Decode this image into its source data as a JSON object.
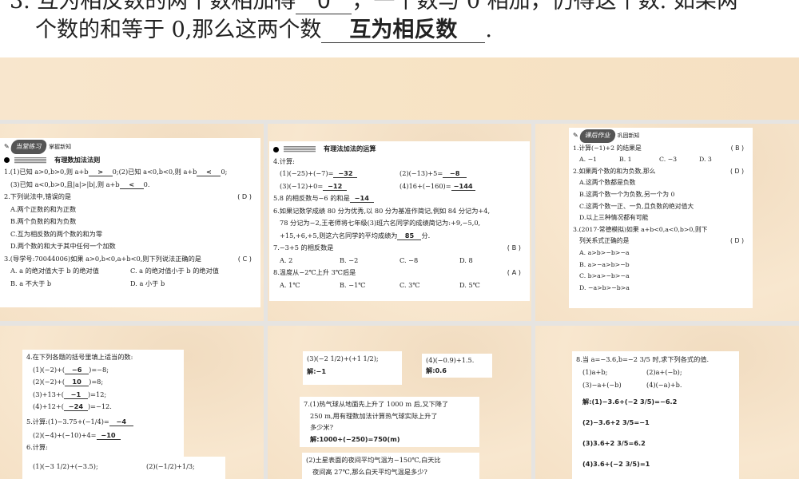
{
  "top": {
    "line1_pre": "3. 互为相反数的两个数相加得",
    "line1_ans": "0",
    "line1_post": "，一个数与 0 相加，仍得这个数. 如果两",
    "line2_pre": "个数的和等于 0,那么这两个数",
    "line2_ans": "互为相反数",
    "line2_post": "."
  },
  "s1": {
    "badge": "当堂练习",
    "badge2": "掌握新知",
    "section": "有理数加法法则",
    "q1a": "1.(1)已知 a>0,b>0,则 a+b",
    "a1": ">",
    "q1b": "0;(2)已知 a<0,b<0,则 a+b",
    "a2": "<",
    "q1c": "0;",
    "q1d": "(3)已知 a<0,b>0,且|a|>|b|,则 a+b",
    "a3": "<",
    "q1e": "0.",
    "q2": "2.下列说法中,错误的是",
    "q2ans": "( D )",
    "q2opts": [
      "A.两个正数的和为正数",
      "B.两个负数的和为负数",
      "C.互为相反数的两个数的和为零",
      "D.两个数的和大于其中任何一个加数"
    ],
    "q3": "3.(导学号:70044006)如果 a>0,b<0,a+b<0,则下列说法正确的是",
    "q3ans": "( C )",
    "q3opts": [
      "A. a 的绝对值大于 b 的绝对值",
      "C. a 的绝对值小于 b 的绝对值",
      "B. a 不大于 b",
      "D. a 小于 b"
    ]
  },
  "s2": {
    "section": "有理法加法的运算",
    "q4": "4.计算:",
    "c1": "(1)(−25)+(−7)=",
    "a1": "−32",
    "c2": "(2)(−13)+5=",
    "a2": "−8",
    "c3": "(3)(−12)+0=",
    "a3": "−12",
    "c4": "(4)16+(−160)=",
    "a4": "−144",
    "q5": "5.8 的相反数与−6 的和是",
    "a5": "−14",
    "q6a": "6.如果记数学成绩 80 分为优秀,以 80 分为基准作简记,例如 84 分记为+4,",
    "q6b": "78 分记为−2,王老师将七年级(3)班六名同学的成绩简记为:+9,−5,0,",
    "q6c": "+15,+6,+5,则这六名同学的平均成绩为",
    "a6": "85",
    "q6d": "分.",
    "q7": "7.−3+5 的相反数是",
    "q7ans": "( B )",
    "q7opts": [
      "A. 2",
      "B. −2",
      "C. −8",
      "D. 8"
    ],
    "q8": "8.温度从−2℃上升 3℃后是",
    "q8ans": "( A )",
    "q8opts": [
      "A. 1℃",
      "B. −1℃",
      "C. 3℃",
      "D. 5℃"
    ]
  },
  "s3": {
    "badge": "课后作业",
    "badge2": "巩固新知",
    "q1": "1.计算(−1)+2 的结果是",
    "q1ans": "( B )",
    "q1opts": [
      "A. −1",
      "B. 1",
      "C. −3",
      "D. 3"
    ],
    "q2": "2.如果两个数的和为负数,那么",
    "q2ans": "( D )",
    "q2opts": [
      "A.这两个数都是负数",
      "B.这两个数一个为负数,另一个为 0",
      "C.这两个数一正、一负,且负数的绝对值大",
      "D.以上三种情况都有可能"
    ],
    "q3a": "3.(2017·常德模拟)如果 a+b<0,a<0,b>0,则下",
    "q3b": "列关系式正确的是",
    "q3ans": "( D )",
    "q3opts": [
      "A. a>b>−b>−a",
      "B. a>−a>b>−b",
      "C. b>a>−b>−a",
      "D. −a>b>−b>a"
    ]
  },
  "s4": {
    "q4": "4.在下列各题的括号里填上适当的数:",
    "l1a": "(1)(−2)+(",
    "f1": "−6",
    "l1b": ")=−8;",
    "l2a": "(2)(−2)+(",
    "f2": "10",
    "l2b": ")=8;",
    "l3a": "(3)+13+(",
    "f3": "−1",
    "l3b": ")=12;",
    "l4a": "(4)+12+(",
    "f4": "−24",
    "l4b": ")=−12.",
    "q5a": "5.计算:(1)−3.75+(−1/4)=",
    "a5a": "−4",
    "q5b": "(2)(−4)+(−10)+4=",
    "a5b": "−10",
    "q6": "6.计算:",
    "q6a": "(1)(−3 1/2)+(−3.5);",
    "q6b": "(2)(−1/2)+1/3;"
  },
  "s5": {
    "p3": "(3)(−2 1/2)+(+1 1/2);",
    "p3sol": "解:−1",
    "p4": "(4)(−0.9)+1.5.",
    "p4sol": "解:0.6",
    "q7a": "7.(1)热气球从地面先上升了 1000 m 后,又下降了",
    "q7b": "250 m,用有理数加法计算热气球实际上升了",
    "q7c": "多少米?",
    "q7sol": "解:1000+(−250)=750(m)",
    "q72a": "(2)土星表面的夜间平均气温为−150℃,白天比",
    "q72b": "夜间高 27℃,那么白天平均气温是多少?"
  },
  "s6": {
    "q8": "8.当 a=−3.6,b=−2 3/5 时,求下列各式的值.",
    "e1": "(1)a+b;",
    "e2": "(2)a+(−b);",
    "e3": "(3)−a+(−b)",
    "e4": "(4)(−a)+b.",
    "sol1": "解:(1)−3.6+(−2 3/5)=−6.2",
    "sol2": "(2)−3.6+2 3/5=−1",
    "sol3": "(3)3.6+2 3/5=6.2",
    "sol4": "(4)3.6+(−2 3/5)=1"
  }
}
